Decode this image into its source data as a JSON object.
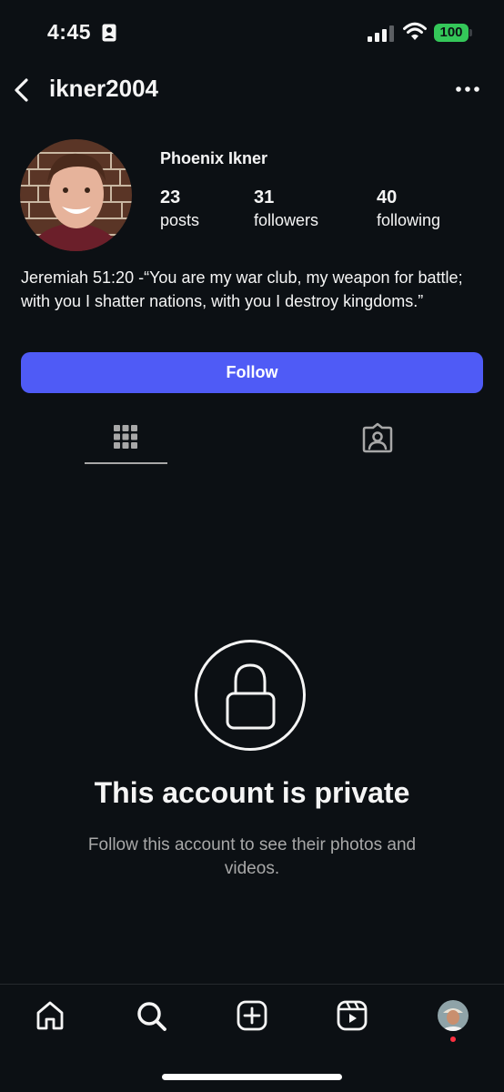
{
  "status_bar": {
    "time": "4:45",
    "battery": "100",
    "icons": [
      "person-card-icon",
      "cellular-signal-icon",
      "wifi-icon",
      "battery-icon"
    ],
    "battery_color": "#34c759"
  },
  "header": {
    "username": "ikner2004",
    "icons": [
      "back-chevron-icon",
      "more-dots-icon"
    ]
  },
  "profile": {
    "display_name": "Phoenix Ikner",
    "stats": [
      {
        "count": "23",
        "label": "posts"
      },
      {
        "count": "31",
        "label": "followers"
      },
      {
        "count": "40",
        "label": "following"
      }
    ],
    "bio": "Jeremiah 51:20 -“You are my war club, my weapon for battle; with you I shatter nations, with you I destroy kingdoms.”"
  },
  "follow_button": {
    "label": "Follow",
    "color": "#4f5bf6"
  },
  "tabs": [
    {
      "name": "posts-grid",
      "icon": "grid-icon",
      "active": true
    },
    {
      "name": "tagged",
      "icon": "tagged-person-icon",
      "active": false
    }
  ],
  "private_notice": {
    "icon": "lock-icon",
    "title": "This account is private",
    "subtitle": "Follow this account to see their photos and videos."
  },
  "bottom_nav": [
    {
      "name": "home",
      "icon": "home-icon"
    },
    {
      "name": "search",
      "icon": "search-icon"
    },
    {
      "name": "create",
      "icon": "plus-square-icon"
    },
    {
      "name": "reels",
      "icon": "reels-icon"
    },
    {
      "name": "profile",
      "icon": "avatar-icon",
      "notification_dot_color": "#ff3040"
    }
  ],
  "colors": {
    "background": "#0c1014",
    "secondary_text": "#a8a8a8"
  }
}
